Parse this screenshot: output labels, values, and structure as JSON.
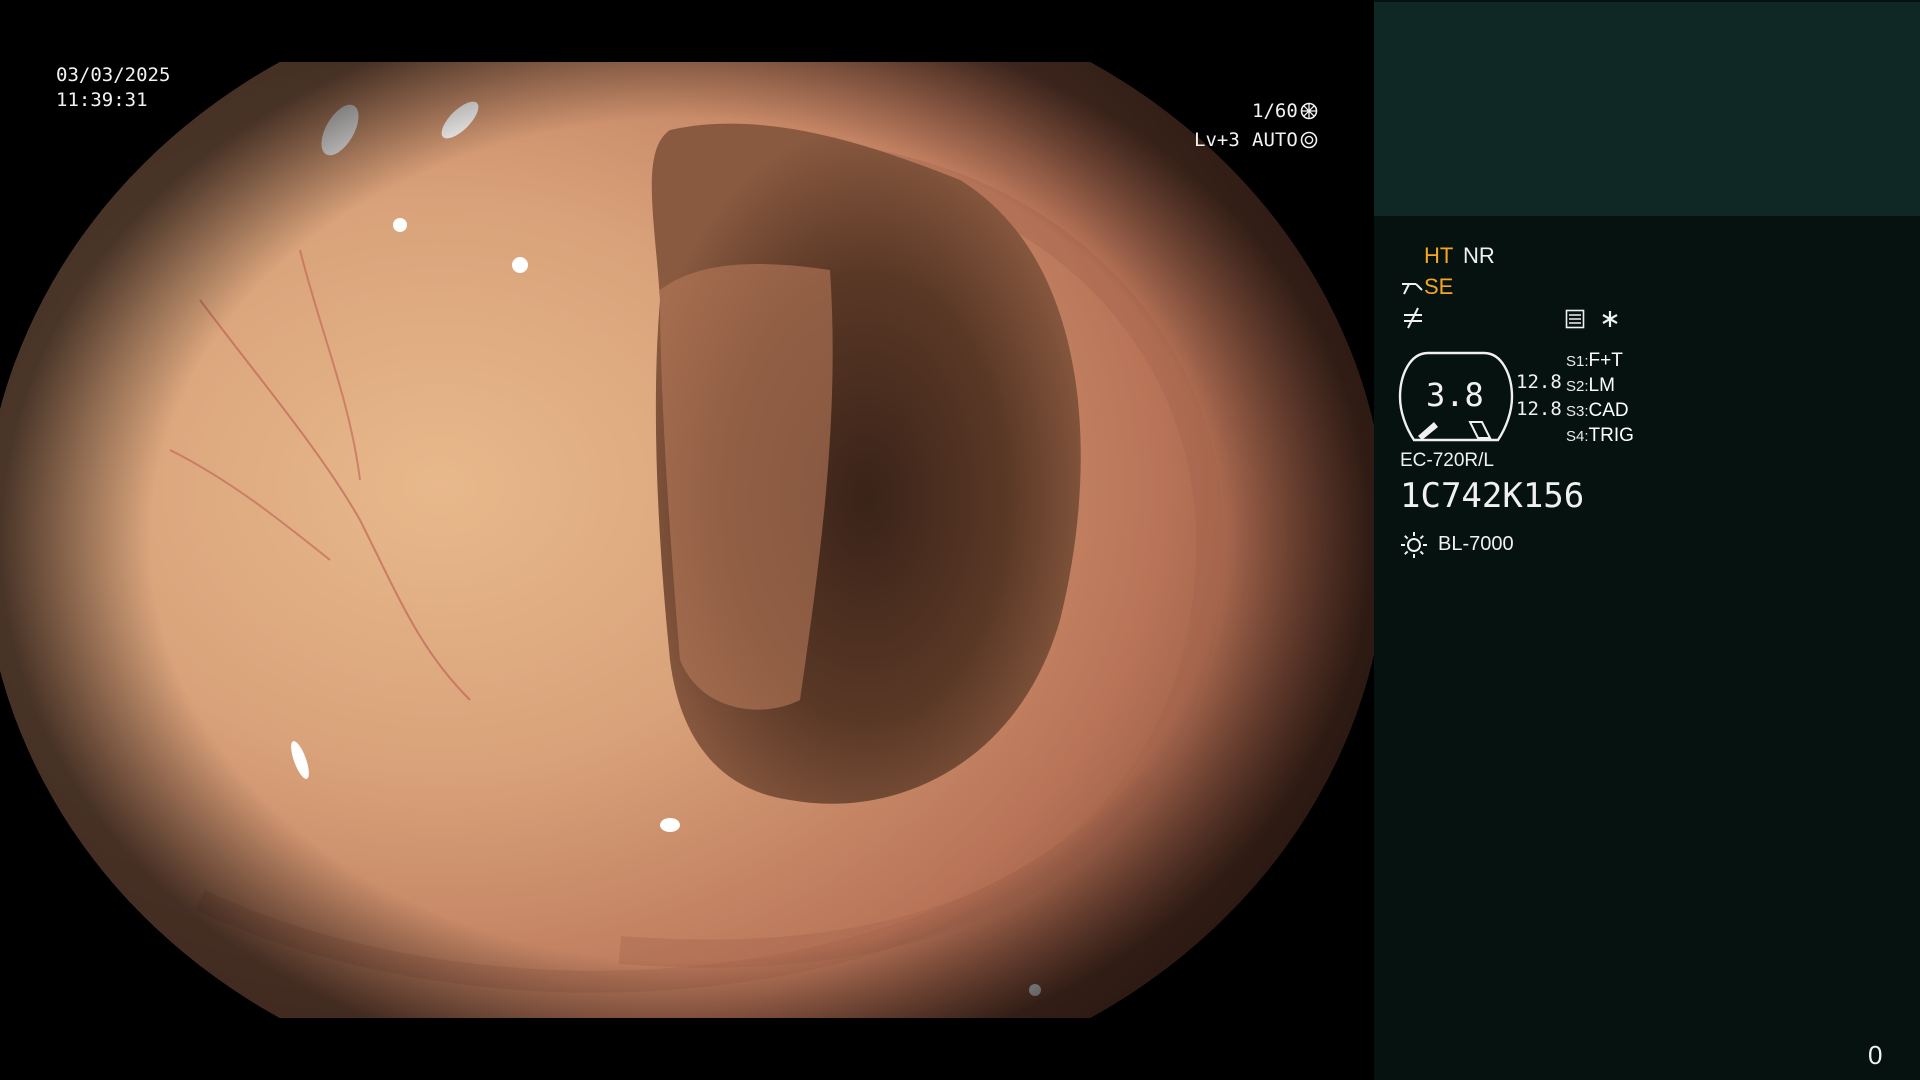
{
  "overlay": {
    "date": "03/03/2025",
    "time": "11:39:31",
    "shutter": "1/60",
    "level": "Lv+3",
    "mode": "AUTO"
  },
  "panel": {
    "ht": "HT",
    "nr": "NR",
    "se": "SE",
    "gauge_value": "3.8",
    "zoom_values": [
      "12.8",
      "12.8"
    ],
    "switches": [
      {
        "key": "S1",
        "value": "F+T"
      },
      {
        "key": "S2",
        "value": "LM"
      },
      {
        "key": "S3",
        "value": "CAD"
      },
      {
        "key": "S4",
        "value": "TRIG"
      }
    ],
    "scope_model": "EC-720R/L",
    "serial": "1C742K156",
    "light_source": "BL-7000",
    "corner_counter": "0"
  },
  "colors": {
    "orange_accent": "#f5a623",
    "panel_bg": "#051210",
    "panel_top_bg": "#0f2725"
  },
  "icons": [
    "shutter-aperture-icon",
    "auto-iris-icon",
    "scope-angle-icon",
    "freeze-icon",
    "memo-icon",
    "asterisk-icon",
    "light-source-sun-icon"
  ]
}
